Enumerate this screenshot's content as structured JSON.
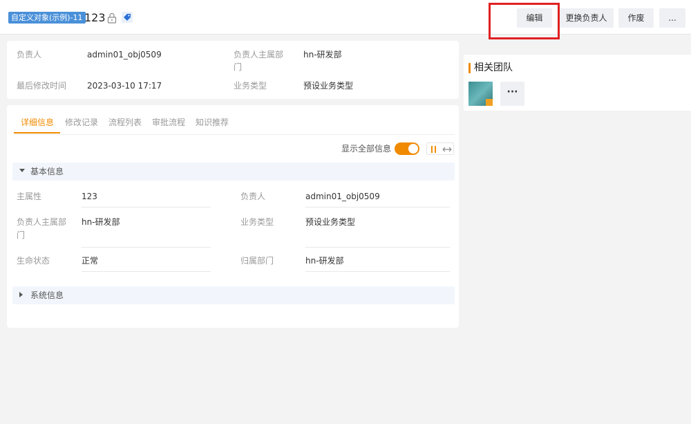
{
  "header": {
    "object_type": "自定义对象(示例)-11",
    "object_name": "123",
    "buttons": {
      "edit": "编辑",
      "change_owner": "更换负责人",
      "void": "作废",
      "more": "..."
    }
  },
  "summary": {
    "owner_label": "负责人",
    "owner_value": "admin01_obj0509",
    "owner_dept_label_1": "负责人主属部",
    "owner_dept_label_2": "门",
    "owner_dept_value": "hn-研发部",
    "modified_label": "最后修改时间",
    "modified_value": "2023-03-10 17:17",
    "biz_type_label": "业务类型",
    "biz_type_value": "预设业务类型"
  },
  "tabs": [
    "详细信息",
    "修改记录",
    "流程列表",
    "审批流程",
    "知识推荐"
  ],
  "detail": {
    "show_all_label": "显示全部信息",
    "basic_section": "基本信息",
    "system_section": "系统信息",
    "fields": {
      "main_attr_label": "主属性",
      "main_attr_value": "123",
      "owner_label": "负责人",
      "owner_value": "admin01_obj0509",
      "owner_dept_label_1": "负责人主属部",
      "owner_dept_label_2": "门",
      "owner_dept_value": "hn-研发部",
      "biz_type_label": "业务类型",
      "biz_type_value": "预设业务类型",
      "status_label": "生命状态",
      "status_value": "正常",
      "belong_dept_label": "归属部门",
      "belong_dept_value": "hn-研发部"
    }
  },
  "team": {
    "title": "相关团队",
    "more": "···"
  },
  "colors": {
    "accent": "#f08a00",
    "tag_blue": "#4a90d9",
    "highlight": "#e02020"
  }
}
